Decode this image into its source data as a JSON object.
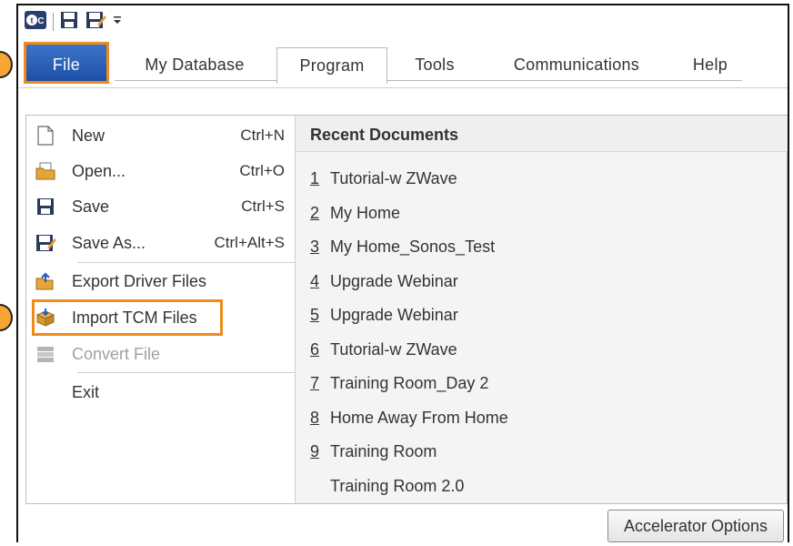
{
  "tabs": {
    "file": "File",
    "my_database": "My Database",
    "program": "Program",
    "tools": "Tools",
    "communications": "Communications",
    "help": "Help"
  },
  "file_menu": {
    "items": [
      {
        "label": "New",
        "shortcut": "Ctrl+N",
        "icon": "new-document-icon"
      },
      {
        "label": "Open...",
        "shortcut": "Ctrl+O",
        "icon": "open-folder-icon"
      },
      {
        "label": "Save",
        "shortcut": "Ctrl+S",
        "icon": "save-icon"
      },
      {
        "label": "Save As...",
        "shortcut": "Ctrl+Alt+S",
        "icon": "save-as-icon"
      },
      {
        "label": "Export Driver Files",
        "shortcut": "",
        "icon": "export-icon"
      },
      {
        "label": "Import TCM Files",
        "shortcut": "",
        "icon": "import-package-icon"
      },
      {
        "label": "Convert File",
        "shortcut": "",
        "icon": "convert-icon",
        "disabled": true
      },
      {
        "label": "Exit",
        "shortcut": "",
        "icon": ""
      }
    ]
  },
  "recent": {
    "header": "Recent Documents",
    "items": [
      {
        "num": "1",
        "name": "Tutorial-w ZWave"
      },
      {
        "num": "2",
        "name": "My Home"
      },
      {
        "num": "3",
        "name": "My Home_Sonos_Test"
      },
      {
        "num": "4",
        "name": "Upgrade Webinar"
      },
      {
        "num": "5",
        "name": "Upgrade Webinar"
      },
      {
        "num": "6",
        "name": "Tutorial-w ZWave"
      },
      {
        "num": "7",
        "name": "Training Room_Day 2"
      },
      {
        "num": "8",
        "name": "Home Away From Home"
      },
      {
        "num": "9",
        "name": "Training Room"
      },
      {
        "num": "",
        "name": "Training Room 2.0"
      }
    ]
  },
  "buttons": {
    "accelerator_options": "Accelerator Options"
  },
  "colors": {
    "file_tab": "#2a5eb8",
    "highlight": "#f08a1c",
    "callout": "#f7a533"
  }
}
